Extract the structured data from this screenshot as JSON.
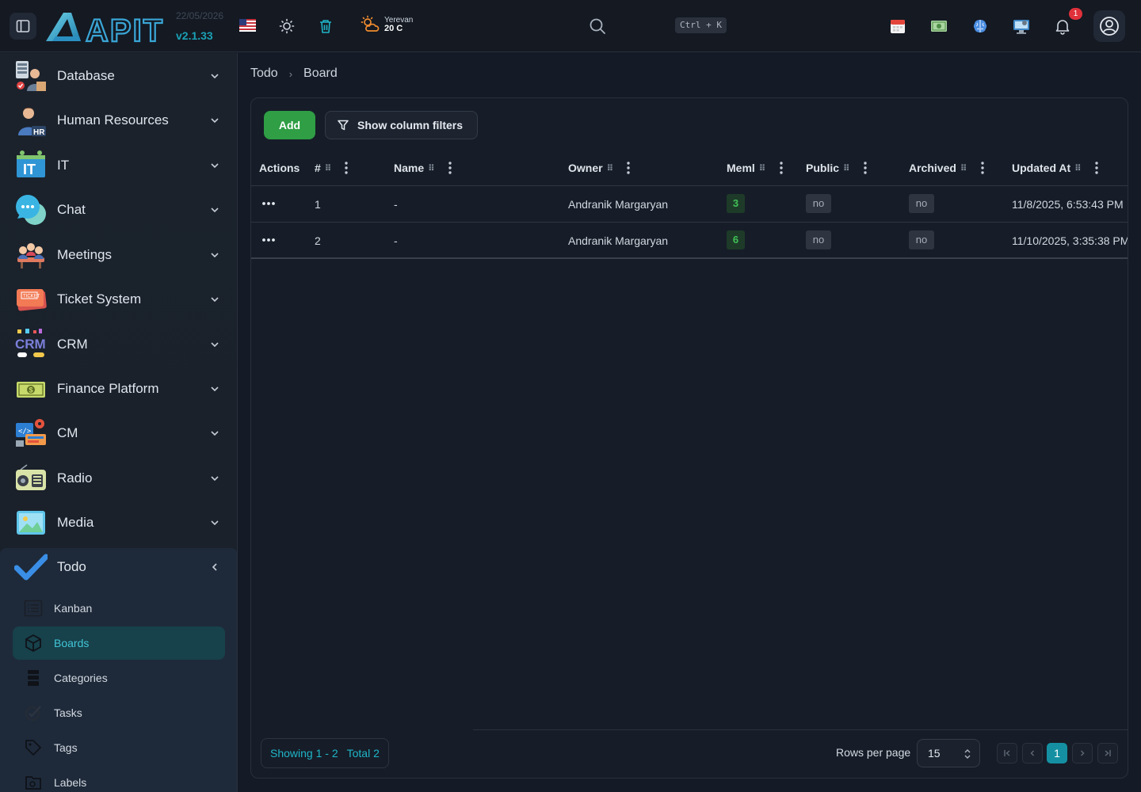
{
  "header": {
    "logo_text": "APIT",
    "date": "22/05/2026",
    "version": "v2.1.33",
    "weather": {
      "city": "Yerevan",
      "temp": "20 C"
    },
    "search_shortcut": "Ctrl + K",
    "notifications_count": "1",
    "icons": [
      "sidebar-toggle-icon",
      "us-flag-icon",
      "sun-icon",
      "trash-icon",
      "weather-icon",
      "search-icon",
      "calendar-icon",
      "money-icon",
      "brain-icon",
      "monitor-icon",
      "bell-icon",
      "user-circle-icon"
    ]
  },
  "sidebar": {
    "items": [
      {
        "label": "Database",
        "icon": "database-icon"
      },
      {
        "label": "Human Resources",
        "icon": "hr-icon"
      },
      {
        "label": "IT",
        "icon": "it-icon"
      },
      {
        "label": "Chat",
        "icon": "chat-icon"
      },
      {
        "label": "Meetings",
        "icon": "meetings-icon"
      },
      {
        "label": "Ticket System",
        "icon": "ticket-icon"
      },
      {
        "label": "CRM",
        "icon": "crm-icon"
      },
      {
        "label": "Finance Platform",
        "icon": "finance-icon"
      },
      {
        "label": "CM",
        "icon": "cm-icon"
      },
      {
        "label": "Radio",
        "icon": "radio-icon"
      },
      {
        "label": "Media",
        "icon": "media-icon"
      }
    ],
    "todo": {
      "label": "Todo",
      "children": [
        {
          "label": "Kanban",
          "icon": "kanban-icon"
        },
        {
          "label": "Boards",
          "icon": "cube-icon",
          "active": true
        },
        {
          "label": "Categories",
          "icon": "stack-icon"
        },
        {
          "label": "Tasks",
          "icon": "tasks-icon"
        },
        {
          "label": "Tags",
          "icon": "tag-icon"
        },
        {
          "label": "Labels",
          "icon": "labels-icon"
        }
      ]
    }
  },
  "breadcrumb": {
    "parent": "Todo",
    "current": "Board"
  },
  "toolbar": {
    "add_label": "Add",
    "filters_label": "Show column filters"
  },
  "table": {
    "columns": [
      "Actions",
      "#",
      "Name",
      "Owner",
      "Meml",
      "Public",
      "Archived",
      "Updated At"
    ],
    "rows": [
      {
        "id": "1",
        "name": "-",
        "owner": "Andranik Margaryan",
        "members": "3",
        "public": "no",
        "archived": "no",
        "updated_at": "11/8/2025, 6:53:43 PM"
      },
      {
        "id": "2",
        "name": "-",
        "owner": "Andranik Margaryan",
        "members": "6",
        "public": "no",
        "archived": "no",
        "updated_at": "11/10/2025, 3:35:38 PM"
      }
    ]
  },
  "footer": {
    "showing": "Showing 1 - 2",
    "total": "Total 2",
    "rows_per_page_label": "Rows per page",
    "rows_per_page": "15",
    "current_page": "1"
  },
  "colors": {
    "accent": "#1590a2",
    "add_button": "#2f9e44",
    "members_badge": "#40c057",
    "notification": "#e0313b"
  }
}
